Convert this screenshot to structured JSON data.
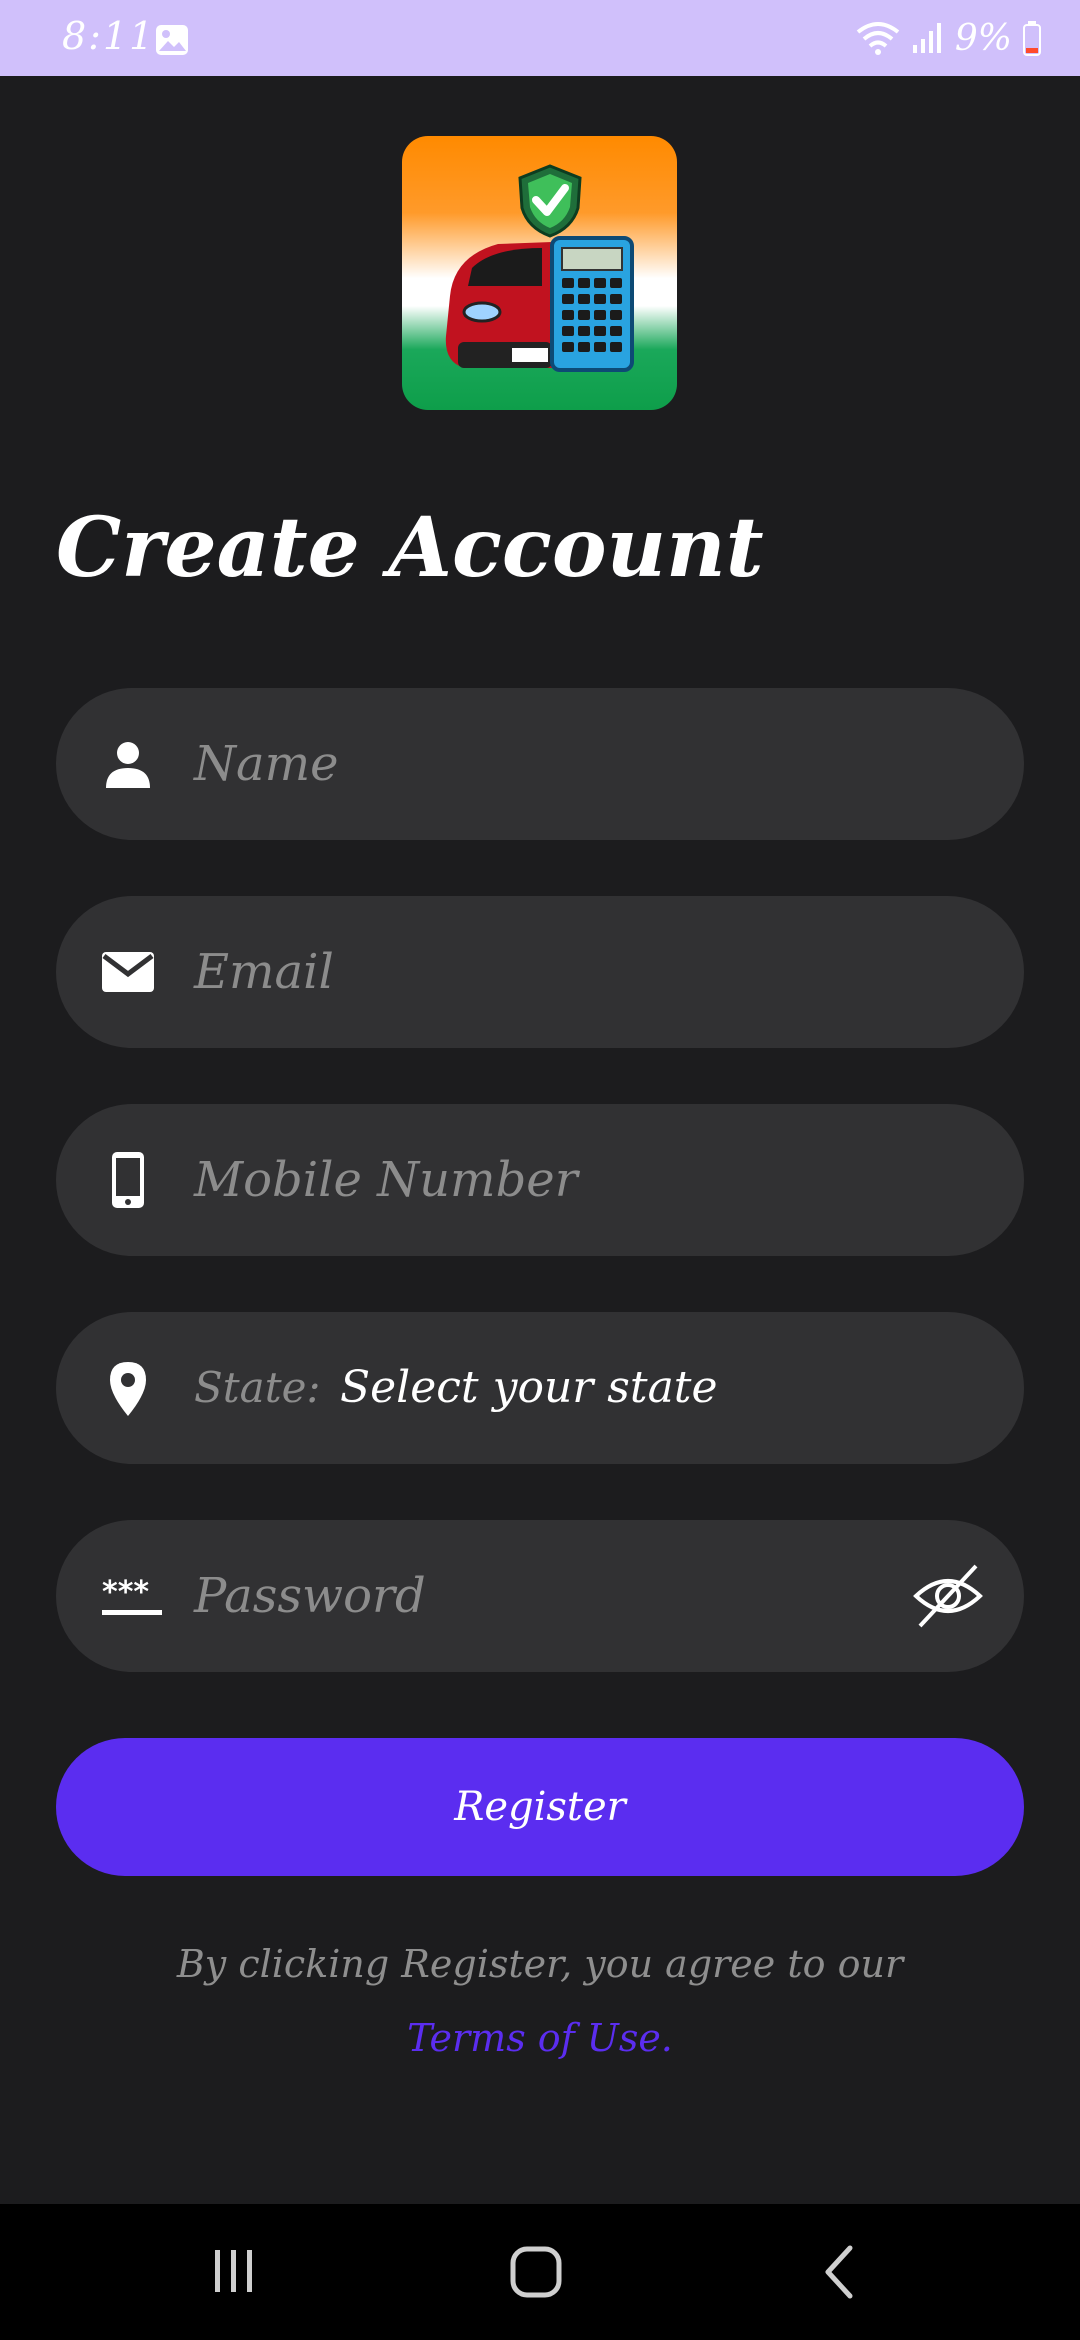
{
  "status_bar": {
    "time": "8:11",
    "battery_percent": "9%",
    "icons": [
      "image-icon",
      "wifi-icon",
      "signal-icon",
      "battery-icon"
    ]
  },
  "logo": {
    "icon": "car-calculator-logo",
    "colors": [
      "#ff8a00",
      "#ffffff",
      "#0e9e4a"
    ]
  },
  "title": "Create Account",
  "form": {
    "name": {
      "placeholder": "Name",
      "icon": "person-icon"
    },
    "email": {
      "placeholder": "Email",
      "icon": "mail-icon"
    },
    "mobile": {
      "placeholder": "Mobile Number",
      "icon": "phone-icon"
    },
    "state": {
      "label": "State:",
      "value": "Select your state",
      "icon": "location-pin-icon"
    },
    "password": {
      "placeholder": "Password",
      "icon": "password-icon",
      "toggle_icon": "eye-off-icon"
    }
  },
  "register_label": "Register",
  "agreement_text": "By clicking Register, you agree to our",
  "terms_link": "Terms of Use.",
  "colors": {
    "accent": "#5b2df0",
    "background": "#1c1c1e",
    "field": "#313133",
    "status_bar": "#d0c0fb"
  },
  "nav_bar": {
    "icons": [
      "recents-icon",
      "home-icon",
      "back-icon"
    ]
  }
}
